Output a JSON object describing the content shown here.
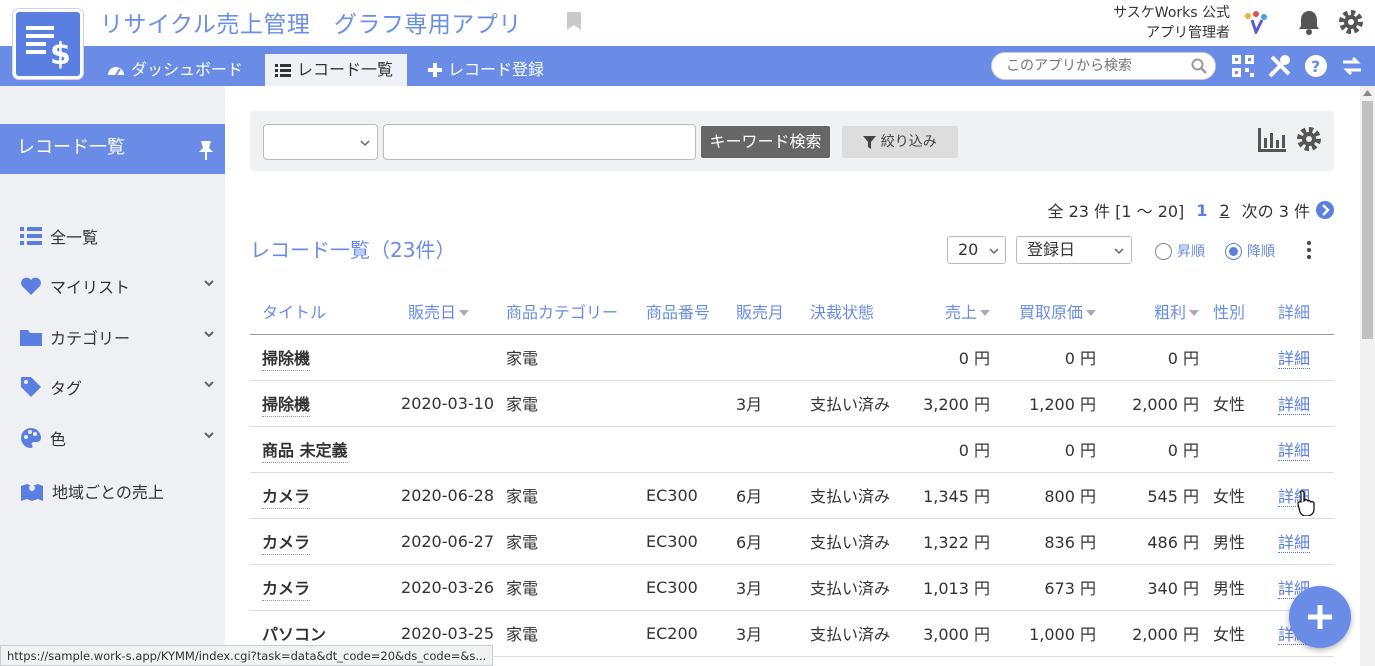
{
  "header": {
    "app_title": "リサイクル売上管理　グラフ専用アプリ",
    "owner_line1": "サスケWorks 公式",
    "owner_line2": "アプリ管理者"
  },
  "nav": {
    "tabs": [
      {
        "label": "ダッシュボード",
        "icon": "speedometer-icon"
      },
      {
        "label": "レコード一覧",
        "icon": "list-icon"
      },
      {
        "label": "レコード登録",
        "icon": "plus-icon"
      }
    ],
    "search_placeholder": "このアプリから検索"
  },
  "sidebar": {
    "heading": "レコード一覧",
    "items": [
      {
        "label": "全一覧",
        "icon": "list-icon"
      },
      {
        "label": "マイリスト",
        "icon": "heart-icon"
      },
      {
        "label": "カテゴリー",
        "icon": "folder-icon"
      },
      {
        "label": "タグ",
        "icon": "tag-icon"
      },
      {
        "label": "色",
        "icon": "palette-icon"
      },
      {
        "label": "地域ごとの売上",
        "icon": "map-icon"
      }
    ]
  },
  "filter": {
    "keyword_button": "キーワード検索",
    "filter_button": "絞り込み"
  },
  "pager": {
    "summary": "全 23 件 [1 ～ 20]",
    "pages": [
      "1",
      "2"
    ],
    "next": "次の 3 件"
  },
  "list": {
    "title": "レコード一覧（23件）",
    "per_page": "20",
    "sort_field": "登録日",
    "asc_label": "昇順",
    "desc_label": "降順",
    "columns": [
      "タイトル",
      "販売日",
      "商品カテゴリー",
      "商品番号",
      "販売月",
      "決裁状態",
      "売上",
      "買取原価",
      "粗利",
      "性別",
      "詳細"
    ],
    "rows": [
      {
        "title": "掃除機",
        "date": "",
        "category": "家電",
        "code": "",
        "month": "",
        "status": "",
        "sales": "0 円",
        "cost": "0 円",
        "profit": "0 円",
        "gender": "",
        "detail": "詳細"
      },
      {
        "title": "掃除機",
        "date": "2020-03-10",
        "category": "家電",
        "code": "",
        "month": "3月",
        "status": "支払い済み",
        "sales": "3,200 円",
        "cost": "1,200 円",
        "profit": "2,000 円",
        "gender": "女性",
        "detail": "詳細"
      },
      {
        "title": "商品 未定義",
        "date": "",
        "category": "",
        "code": "",
        "month": "",
        "status": "",
        "sales": "0 円",
        "cost": "0 円",
        "profit": "0 円",
        "gender": "",
        "detail": "詳細"
      },
      {
        "title": "カメラ",
        "date": "2020-06-28",
        "category": "家電",
        "code": "EC300",
        "month": "6月",
        "status": "支払い済み",
        "sales": "1,345 円",
        "cost": "800 円",
        "profit": "545 円",
        "gender": "女性",
        "detail": "詳細"
      },
      {
        "title": "カメラ",
        "date": "2020-06-27",
        "category": "家電",
        "code": "EC300",
        "month": "6月",
        "status": "支払い済み",
        "sales": "1,322 円",
        "cost": "836 円",
        "profit": "486 円",
        "gender": "男性",
        "detail": "詳細"
      },
      {
        "title": "カメラ",
        "date": "2020-03-26",
        "category": "家電",
        "code": "EC300",
        "month": "3月",
        "status": "支払い済み",
        "sales": "1,013 円",
        "cost": "673 円",
        "profit": "340 円",
        "gender": "男性",
        "detail": "詳細"
      },
      {
        "title": "パソコン",
        "date": "2020-03-25",
        "category": "家電",
        "code": "EC200",
        "month": "3月",
        "status": "支払い済み",
        "sales": "3,000 円",
        "cost": "1,000 円",
        "profit": "2,000 円",
        "gender": "女性",
        "detail": "詳細"
      }
    ]
  },
  "status_url": "https://sample.work-s.app/KYMM/index.cgi?task=data&dt_code=20&ds_code=&s..."
}
